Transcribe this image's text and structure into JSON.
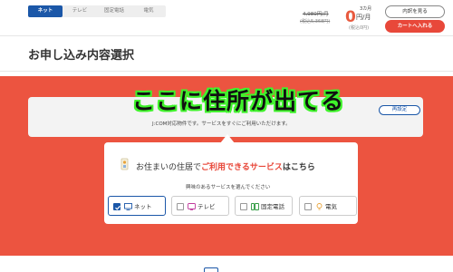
{
  "header": {
    "tabs": [
      {
        "label": "ネット",
        "active": true
      },
      {
        "label": "テレビ",
        "active": false
      },
      {
        "label": "固定電話",
        "active": false
      },
      {
        "label": "電気",
        "active": false
      }
    ],
    "price_old": "4,980円/月",
    "price_old_tax": "(税込5,368円)",
    "free_months": "3カ月",
    "free_zero": "0",
    "free_unit": "円/月",
    "free_tax": "(税込0円)",
    "breakdown_label": "内訳を見る",
    "cart_label": "カートへ入れる"
  },
  "page_title": "お申し込み内容選択",
  "address": {
    "note": "J:COM対応物件です。サービスをすぐにご利用いただけます。",
    "change_label": "再設定"
  },
  "overlay_caption": "ここに住所が出てる",
  "service_select": {
    "heading_pre": "お住まいの住居で",
    "heading_em": "ご利用できるサービス",
    "heading_post": "はこちら",
    "interest_label": "興味のあるサービスを選んでください",
    "options": [
      {
        "label": "ネット",
        "selected": true,
        "icon": "monitor-icon"
      },
      {
        "label": "テレビ",
        "selected": false,
        "icon": "tv-icon"
      },
      {
        "label": "固定電話",
        "selected": false,
        "icon": "phone-icon"
      },
      {
        "label": "電気",
        "selected": false,
        "icon": "bulb-icon"
      }
    ]
  },
  "colors": {
    "brand_blue": "#1b57a8",
    "accent_orange": "#ec5440",
    "cta_red": "#e8483a",
    "caption_outline": "#3ff22b"
  }
}
